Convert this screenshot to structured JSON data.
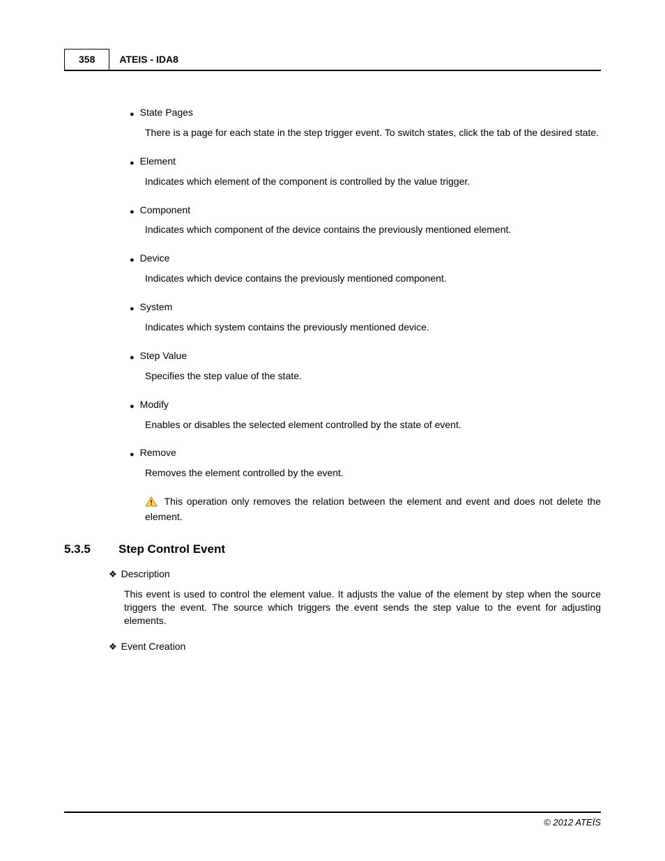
{
  "header": {
    "page_number": "358",
    "doc_title": "ATEIS - IDA8"
  },
  "bullets": [
    {
      "title": "State Pages",
      "desc": "There is a page for each state in the step trigger event. To switch states, click the tab of the desired state."
    },
    {
      "title": "Element",
      "desc": "Indicates which element of the component is controlled by the value trigger."
    },
    {
      "title": "Component",
      "desc": "Indicates which component of the device contains the previously mentioned element."
    },
    {
      "title": "Device",
      "desc": "Indicates which device contains the previously mentioned component."
    },
    {
      "title": "System",
      "desc": "Indicates which system contains the previously mentioned device."
    },
    {
      "title": "Step Value",
      "desc": "Specifies the step value of the state."
    },
    {
      "title": "Modify",
      "desc": "Enables or disables the selected element controlled by the state of event."
    },
    {
      "title": "Remove",
      "desc": "Removes the element controlled by the event.",
      "warn": "This operation only removes the relation between the element and event and does not delete the element."
    }
  ],
  "section": {
    "number": "5.3.5",
    "title": "Step Control Event",
    "desc_label": "Description",
    "desc_text": "This event is used to control the element value. It adjusts the value of the element by step when the source triggers the event. The source which triggers the event sends the step value to the event for adjusting elements.",
    "creation_label": "Event Creation"
  },
  "footer": {
    "copyright": "© 2012 ATEÏS"
  }
}
